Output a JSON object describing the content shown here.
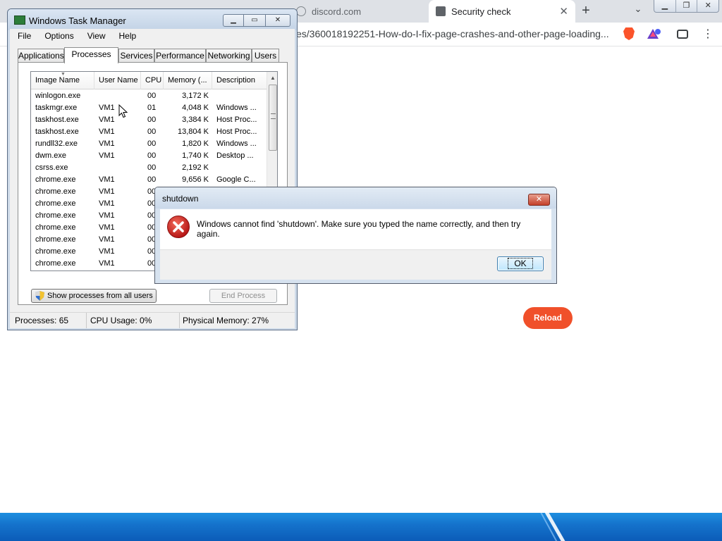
{
  "browser": {
    "tabs": [
      {
        "title": "discord.com"
      },
      {
        "title": "Security check"
      }
    ],
    "url": "es/360018192251-How-do-I-fix-page-crashes-and-other-page-loading...",
    "reload_label": "Reload",
    "menu_icon": "⋮"
  },
  "task_manager": {
    "title": "Windows Task Manager",
    "menu": [
      "File",
      "Options",
      "View",
      "Help"
    ],
    "tabs": [
      "Applications",
      "Processes",
      "Services",
      "Performance",
      "Networking",
      "Users"
    ],
    "active_tab": "Processes",
    "columns": [
      "Image Name",
      "User Name",
      "CPU",
      "Memory (...",
      "Description"
    ],
    "processes": [
      {
        "name": "winlogon.exe",
        "user": "",
        "cpu": "00",
        "memory": "3,172 K",
        "description": ""
      },
      {
        "name": "taskmgr.exe",
        "user": "VM1",
        "cpu": "01",
        "memory": "4,048 K",
        "description": "Windows ..."
      },
      {
        "name": "taskhost.exe",
        "user": "VM1",
        "cpu": "00",
        "memory": "3,384 K",
        "description": "Host Proc..."
      },
      {
        "name": "taskhost.exe",
        "user": "VM1",
        "cpu": "00",
        "memory": "13,804 K",
        "description": "Host Proc..."
      },
      {
        "name": "rundll32.exe",
        "user": "VM1",
        "cpu": "00",
        "memory": "1,820 K",
        "description": "Windows ..."
      },
      {
        "name": "dwm.exe",
        "user": "VM1",
        "cpu": "00",
        "memory": "1,740 K",
        "description": "Desktop ..."
      },
      {
        "name": "csrss.exe",
        "user": "",
        "cpu": "00",
        "memory": "2,192 K",
        "description": ""
      },
      {
        "name": "chrome.exe",
        "user": "VM1",
        "cpu": "00",
        "memory": "9,656 K",
        "description": "Google C..."
      },
      {
        "name": "chrome.exe",
        "user": "VM1",
        "cpu": "00",
        "memory": "",
        "description": ""
      },
      {
        "name": "chrome.exe",
        "user": "VM1",
        "cpu": "00",
        "memory": "",
        "description": ""
      },
      {
        "name": "chrome.exe",
        "user": "VM1",
        "cpu": "00",
        "memory": "",
        "description": ""
      },
      {
        "name": "chrome.exe",
        "user": "VM1",
        "cpu": "00",
        "memory": "",
        "description": ""
      },
      {
        "name": "chrome.exe",
        "user": "VM1",
        "cpu": "00",
        "memory": "",
        "description": ""
      },
      {
        "name": "chrome.exe",
        "user": "VM1",
        "cpu": "00",
        "memory": "",
        "description": ""
      },
      {
        "name": "chrome.exe",
        "user": "VM1",
        "cpu": "00",
        "memory": "",
        "description": ""
      }
    ],
    "show_all_label": "Show processes from all users",
    "end_process_label": "End Process",
    "status": {
      "processes": "Processes: 65",
      "cpu": "CPU Usage: 0%",
      "memory": "Physical Memory: 27%"
    }
  },
  "dialog": {
    "title": "shutdown",
    "message": "Windows cannot find 'shutdown'. Make sure you typed the name correctly, and then try again.",
    "ok_label": "OK",
    "icon": "error-icon"
  },
  "colors": {
    "reload_button": "#f0502a",
    "taskbar": "#1573cc",
    "error_red": "#d42a2a"
  }
}
